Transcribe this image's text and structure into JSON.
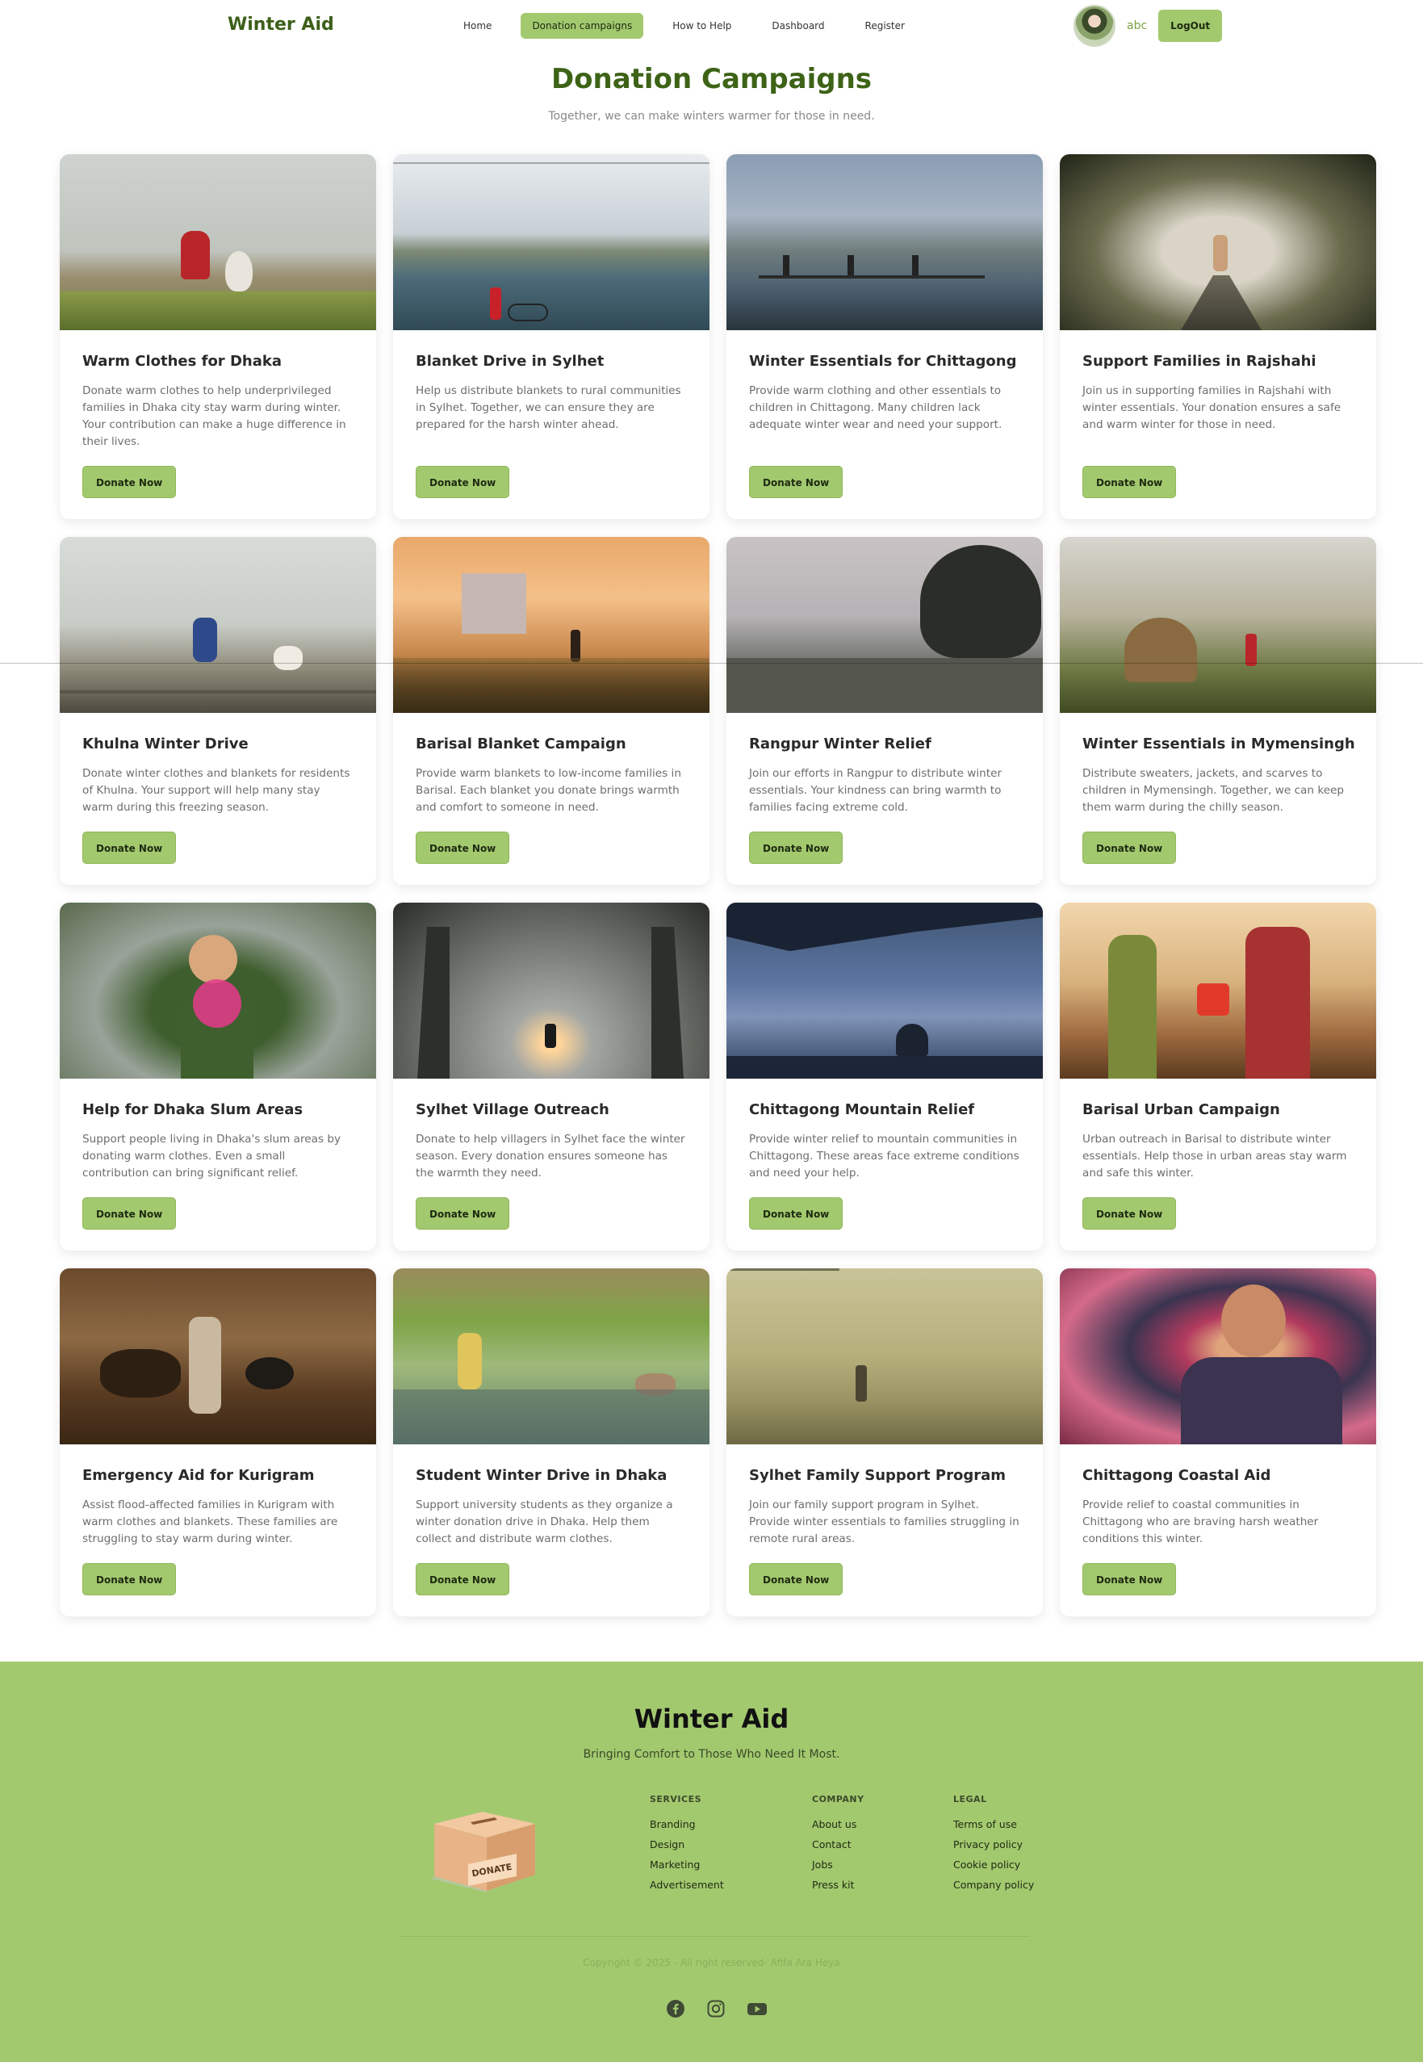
{
  "nav": {
    "brand": "Winter Aid",
    "links": [
      {
        "label": "Home",
        "active": false
      },
      {
        "label": "Donation campaigns",
        "active": true
      },
      {
        "label": "How to Help",
        "active": false
      },
      {
        "label": "Dashboard",
        "active": false
      },
      {
        "label": "Register",
        "active": false
      }
    ],
    "username": "abc",
    "logout_label": "LogOut"
  },
  "hero": {
    "title": "Donation Campaigns",
    "subtitle": "Together, we can make winters warmer for those in need."
  },
  "campaigns": [
    {
      "title": "Warm Clothes for Dhaka",
      "description": "Donate warm clothes to help underprivileged families in Dhaka city stay warm during winter. Your contribution can make a huge difference in their lives.",
      "button": "Donate Now"
    },
    {
      "title": "Blanket Drive in Sylhet",
      "description": "Help us distribute blankets to rural communities in Sylhet. Together, we can ensure they are prepared for the harsh winter ahead.",
      "button": "Donate Now"
    },
    {
      "title": "Winter Essentials for Chittagong",
      "description": "Provide warm clothing and other essentials to children in Chittagong. Many children lack adequate winter wear and need your support.",
      "button": "Donate Now"
    },
    {
      "title": "Support Families in Rajshahi",
      "description": "Join us in supporting families in Rajshahi with winter essentials. Your donation ensures a safe and warm winter for those in need.",
      "button": "Donate Now"
    },
    {
      "title": "Khulna Winter Drive",
      "description": "Donate winter clothes and blankets for residents of Khulna. Your support will help many stay warm during this freezing season.",
      "button": "Donate Now"
    },
    {
      "title": "Barisal Blanket Campaign",
      "description": "Provide warm blankets to low-income families in Barisal. Each blanket you donate brings warmth and comfort to someone in need.",
      "button": "Donate Now"
    },
    {
      "title": "Rangpur Winter Relief",
      "description": "Join our efforts in Rangpur to distribute winter essentials. Your kindness can bring warmth to families facing extreme cold.",
      "button": "Donate Now"
    },
    {
      "title": "Winter Essentials in Mymensingh",
      "description": "Distribute sweaters, jackets, and scarves to children in Mymensingh. Together, we can keep them warm during the chilly season.",
      "button": "Donate Now"
    },
    {
      "title": "Help for Dhaka Slum Areas",
      "description": "Support people living in Dhaka's slum areas by donating warm clothes. Even a small contribution can bring significant relief.",
      "button": "Donate Now"
    },
    {
      "title": "Sylhet Village Outreach",
      "description": "Donate to help villagers in Sylhet face the winter season. Every donation ensures someone has the warmth they need.",
      "button": "Donate Now"
    },
    {
      "title": "Chittagong Mountain Relief",
      "description": "Provide winter relief to mountain communities in Chittagong. These areas face extreme conditions and need your help.",
      "button": "Donate Now"
    },
    {
      "title": "Barisal Urban Campaign",
      "description": "Urban outreach in Barisal to distribute winter essentials. Help those in urban areas stay warm and safe this winter.",
      "button": "Donate Now"
    },
    {
      "title": "Emergency Aid for Kurigram",
      "description": "Assist flood-affected families in Kurigram with warm clothes and blankets. These families are struggling to stay warm during winter.",
      "button": "Donate Now"
    },
    {
      "title": "Student Winter Drive in Dhaka",
      "description": "Support university students as they organize a winter donation drive in Dhaka. Help them collect and distribute warm clothes.",
      "button": "Donate Now"
    },
    {
      "title": "Sylhet Family Support Program",
      "description": "Join our family support program in Sylhet. Provide winter essentials to families struggling in remote rural areas.",
      "button": "Donate Now"
    },
    {
      "title": "Chittagong Coastal Aid",
      "description": "Provide relief to coastal communities in Chittagong who are braving harsh weather conditions this winter.",
      "button": "Donate Now"
    }
  ],
  "footer": {
    "brand": "Winter Aid",
    "tagline": "Bringing Comfort to Those Who Need It Most.",
    "box_label": "DONATE",
    "services": {
      "heading": "SERVICES",
      "links": [
        "Branding",
        "Design",
        "Marketing",
        "Advertisement"
      ]
    },
    "company": {
      "heading": "COMPANY",
      "links": [
        "About us",
        "Contact",
        "Jobs",
        "Press kit"
      ]
    },
    "legal": {
      "heading": "LEGAL",
      "links": [
        "Terms of use",
        "Privacy policy",
        "Cookie policy",
        "Company policy"
      ]
    },
    "copyright": "Copyright © 2025 - All right reserved- Afifa Ara Heya",
    "socials": [
      "facebook-icon",
      "instagram-icon",
      "youtube-icon"
    ]
  },
  "colors": {
    "accent": "#a3c96f",
    "brand_text": "#3d6317",
    "footer_bg": "#a3c96f"
  }
}
